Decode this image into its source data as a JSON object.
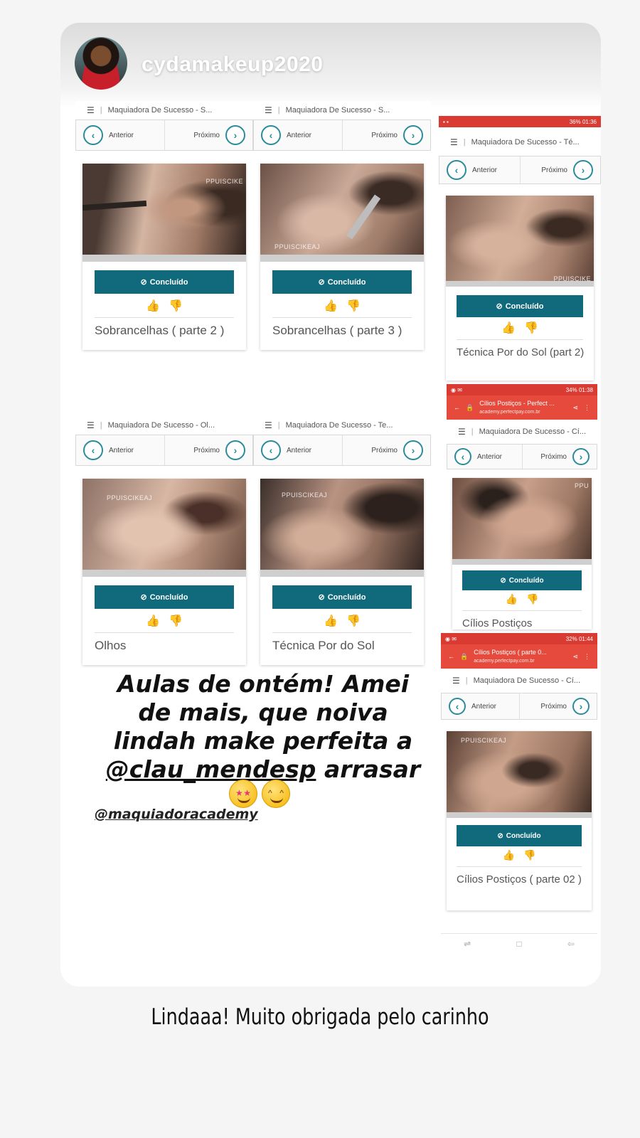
{
  "story": {
    "username": "cydamakeup2020",
    "caption_lines": [
      "Aulas de ontém! Amei",
      "de mais, que noiva",
      "lindah make perfeita a"
    ],
    "caption_mention": "@clau_mendesp",
    "caption_end": "arrasar",
    "academy_handle": "@maquiadoracademy"
  },
  "common": {
    "prev_label": "Anterior",
    "next_label": "Próximo",
    "done_label": "Concluído",
    "done_icon": "check-circle-icon",
    "like_icon": "thumbs-up-icon",
    "dislike_icon": "thumbs-down-icon"
  },
  "lessons": [
    {
      "course": "Maquiadora De Sucesso - S...",
      "title": "Sobrancelhas ( parte 2 )",
      "watermark": "PPUISCIKE"
    },
    {
      "course": "Maquiadora De Sucesso - S...",
      "title": "Sobrancelhas ( parte 3 )",
      "watermark": "PPUISCIKEAJ"
    },
    {
      "course": "Maquiadora De Sucesso - Ol...",
      "title": "Olhos",
      "watermark": "PPUISCIKEAJ"
    },
    {
      "course": "Maquiadora De Sucesso - Te...",
      "title": "Técnica Por do Sol",
      "watermark": "PPUISCIKEAJ"
    }
  ],
  "phones": [
    {
      "status_right": "36% 01:36",
      "course": "Maquiadora De Sucesso - Té...",
      "title": "Técnica Por do Sol (part 2)",
      "watermark": "PPUISCIKE"
    },
    {
      "status_right": "34% 01:38",
      "url_title": "Cílios Postiços - Perfect ...",
      "url_sub": "academy.perfectpay.com.br",
      "course": "Maquiadora De Sucesso - Cí...",
      "title": "Cílios Postiços",
      "watermark": "PPU"
    },
    {
      "status_right": "32% 01:44",
      "url_title": "Cílios Postiços ( parte 0...",
      "url_sub": "academy.perfectpay.com.br",
      "course": "Maquiadora De Sucesso - Cí...",
      "title": "Cílios Postiços ( parte 02 )",
      "watermark": "PPUISCIKEAJ"
    }
  ],
  "reply_text": "Lindaaa! Muito obrigada pelo carinho",
  "colors": {
    "teal_button": "#116a7b",
    "accent": "#2a8c9a",
    "chrome_red": "#e64a3c"
  }
}
